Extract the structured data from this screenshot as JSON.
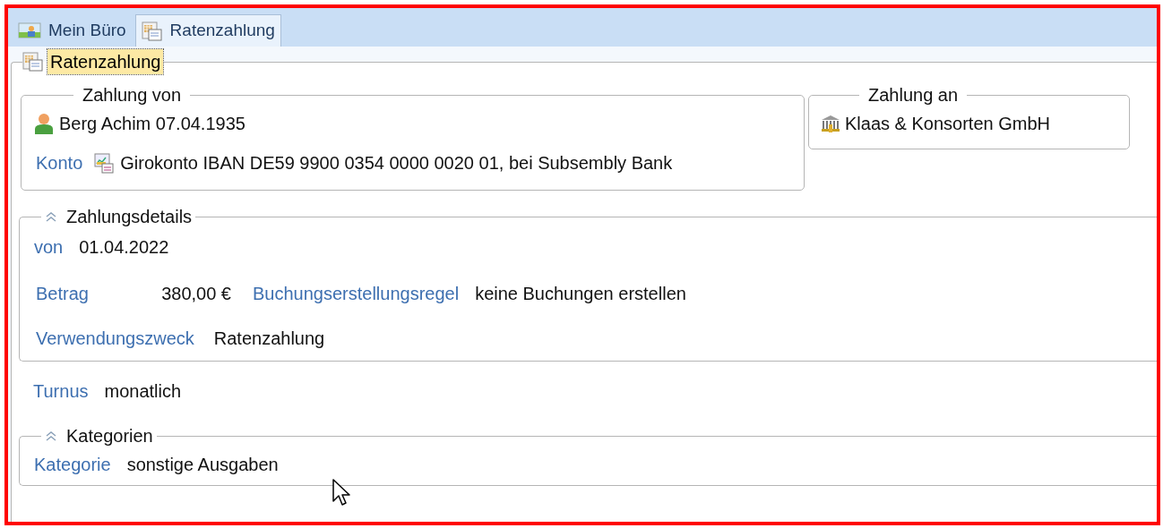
{
  "tabs": [
    {
      "label": "Mein Büro",
      "kind": "desk",
      "selected": false
    },
    {
      "label": "Ratenzahlung",
      "kind": "form",
      "selected": true
    }
  ],
  "panel": {
    "title": "Ratenzahlung",
    "focused": true
  },
  "payer": {
    "legend": "Zahlung von",
    "person": "Berg Achim 07.04.1935",
    "account_label": "Konto",
    "account": "Girokonto IBAN DE59 9900 0354 0000 0020 01, bei Subsembly Bank"
  },
  "payee": {
    "legend": "Zahlung an",
    "name": "Klaas & Konsorten GmbH"
  },
  "details": {
    "legend": "Zahlungsdetails",
    "expanded": true,
    "from_label": "von",
    "from": "01.04.2022",
    "amount_label": "Betrag",
    "amount": "380,00 €",
    "rule_label": "Buchungserstellungsregel",
    "rule": "keine Buchungen erstellen",
    "purpose_label": "Verwendungszweck",
    "purpose": "Ratenzahlung"
  },
  "interval": {
    "label": "Turnus",
    "value": "monatlich"
  },
  "categories": {
    "legend": "Kategorien",
    "expanded": true,
    "label": "Kategorie",
    "value": "sonstige Ausgaben"
  }
}
